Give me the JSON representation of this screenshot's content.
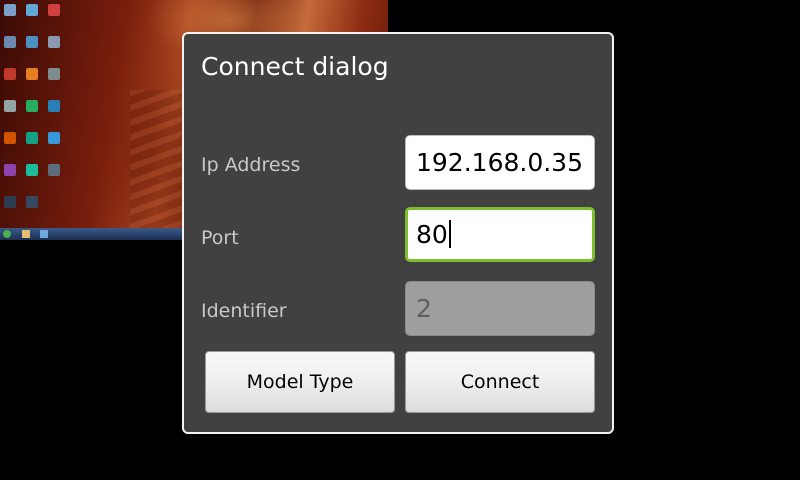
{
  "dialog": {
    "title": "Connect dialog",
    "fields": {
      "ip_address": {
        "label": "Ip Address",
        "value": "192.168.0.35"
      },
      "port": {
        "label": "Port",
        "value": "80"
      },
      "identifier": {
        "label": "Identifier",
        "value": "2"
      }
    },
    "buttons": {
      "model_type": "Model Type",
      "connect": "Connect"
    }
  },
  "colors": {
    "dialog_background": "#414141",
    "dialog_border": "#f2f2f2",
    "focus_border": "#7fbf2f",
    "disabled_field": "#9e9e9e"
  },
  "icons": [
    "desktop-icon",
    "start-button-icon",
    "taskbar-icon"
  ]
}
